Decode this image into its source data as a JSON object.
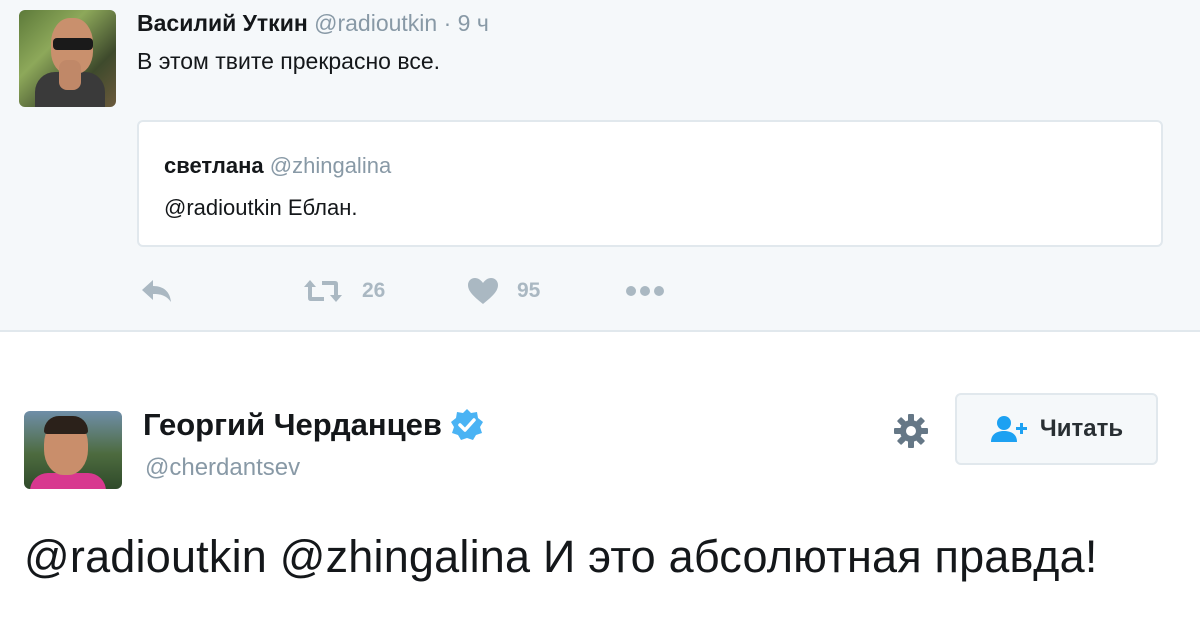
{
  "tweet1": {
    "author_name": "Василий Уткин",
    "author_handle": "@radioutkin",
    "time": "· 9 ч",
    "text": "В этом твите прекрасно все.",
    "quoted": {
      "author_name": "светлана",
      "author_handle": "@zhingalina",
      "text": "@radioutkin Еблан."
    },
    "actions": {
      "reply_icon": "reply-icon",
      "retweet_icon": "retweet-icon",
      "retweet_count": "26",
      "like_icon": "heart-icon",
      "like_count": "95",
      "more_icon": "more-dots-icon"
    }
  },
  "tweet2": {
    "author_name": "Георгий Черданцев",
    "author_handle": "@cherdantsev",
    "verified": true,
    "follow_label": "Читать",
    "text": "@radioutkin @zhingalina И это абсолютная правда!"
  },
  "colors": {
    "background_top": "#f5f8fa",
    "text_primary": "#14171a",
    "text_secondary": "#8899a6",
    "icon_muted": "#aab8c2",
    "verified_blue": "#4ab3f4",
    "follow_icon_blue": "#1da1f2"
  }
}
